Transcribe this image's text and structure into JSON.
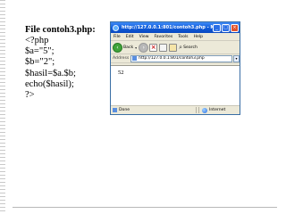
{
  "slide": {
    "title": "File contoh3.php:",
    "code_lines": [
      "<?php",
      "$a=\"5\";",
      "$b=\"2\";",
      "$hasil=$a.$b;",
      "echo($hasil);",
      "?>"
    ]
  },
  "browser": {
    "window_title": "http://127.0.0.1:801/contoh3.php - Micros...",
    "menu": [
      "File",
      "Edit",
      "View",
      "Favorites",
      "Tools",
      "Help"
    ],
    "toolbar": {
      "back_label": "Back",
      "search_label": "Search"
    },
    "address": {
      "label": "Address",
      "url": "http://127.0.0.1:801/contoh3.php",
      "go_label": "Go",
      "links_label": "Links"
    },
    "page_content": "52",
    "status": {
      "text": "Done",
      "zone": "Internet"
    },
    "colors": {
      "titlebar": "#0f5bd8",
      "chrome": "#ece9d8",
      "border": "#3a6ea5"
    }
  }
}
